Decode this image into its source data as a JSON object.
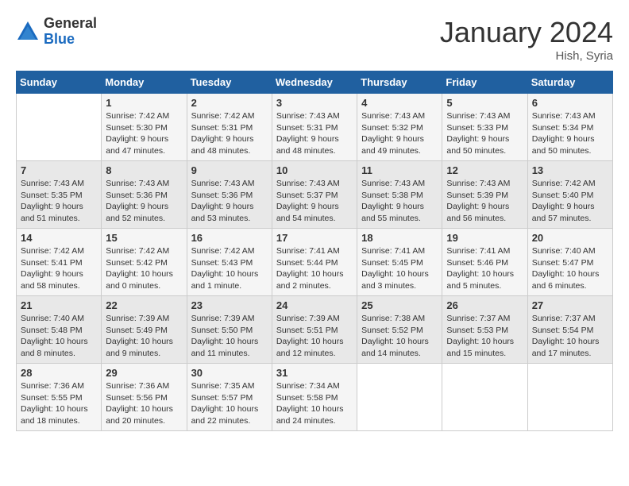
{
  "logo": {
    "general": "General",
    "blue": "Blue"
  },
  "title": "January 2024",
  "location": "Hish, Syria",
  "days_header": [
    "Sunday",
    "Monday",
    "Tuesday",
    "Wednesday",
    "Thursday",
    "Friday",
    "Saturday"
  ],
  "weeks": [
    [
      {
        "day": "",
        "info": ""
      },
      {
        "day": "1",
        "info": "Sunrise: 7:42 AM\nSunset: 5:30 PM\nDaylight: 9 hours and 47 minutes."
      },
      {
        "day": "2",
        "info": "Sunrise: 7:42 AM\nSunset: 5:31 PM\nDaylight: 9 hours and 48 minutes."
      },
      {
        "day": "3",
        "info": "Sunrise: 7:43 AM\nSunset: 5:31 PM\nDaylight: 9 hours and 48 minutes."
      },
      {
        "day": "4",
        "info": "Sunrise: 7:43 AM\nSunset: 5:32 PM\nDaylight: 9 hours and 49 minutes."
      },
      {
        "day": "5",
        "info": "Sunrise: 7:43 AM\nSunset: 5:33 PM\nDaylight: 9 hours and 50 minutes."
      },
      {
        "day": "6",
        "info": "Sunrise: 7:43 AM\nSunset: 5:34 PM\nDaylight: 9 hours and 50 minutes."
      }
    ],
    [
      {
        "day": "7",
        "info": "Sunrise: 7:43 AM\nSunset: 5:35 PM\nDaylight: 9 hours and 51 minutes."
      },
      {
        "day": "8",
        "info": "Sunrise: 7:43 AM\nSunset: 5:36 PM\nDaylight: 9 hours and 52 minutes."
      },
      {
        "day": "9",
        "info": "Sunrise: 7:43 AM\nSunset: 5:36 PM\nDaylight: 9 hours and 53 minutes."
      },
      {
        "day": "10",
        "info": "Sunrise: 7:43 AM\nSunset: 5:37 PM\nDaylight: 9 hours and 54 minutes."
      },
      {
        "day": "11",
        "info": "Sunrise: 7:43 AM\nSunset: 5:38 PM\nDaylight: 9 hours and 55 minutes."
      },
      {
        "day": "12",
        "info": "Sunrise: 7:43 AM\nSunset: 5:39 PM\nDaylight: 9 hours and 56 minutes."
      },
      {
        "day": "13",
        "info": "Sunrise: 7:42 AM\nSunset: 5:40 PM\nDaylight: 9 hours and 57 minutes."
      }
    ],
    [
      {
        "day": "14",
        "info": "Sunrise: 7:42 AM\nSunset: 5:41 PM\nDaylight: 9 hours and 58 minutes."
      },
      {
        "day": "15",
        "info": "Sunrise: 7:42 AM\nSunset: 5:42 PM\nDaylight: 10 hours and 0 minutes."
      },
      {
        "day": "16",
        "info": "Sunrise: 7:42 AM\nSunset: 5:43 PM\nDaylight: 10 hours and 1 minute."
      },
      {
        "day": "17",
        "info": "Sunrise: 7:41 AM\nSunset: 5:44 PM\nDaylight: 10 hours and 2 minutes."
      },
      {
        "day": "18",
        "info": "Sunrise: 7:41 AM\nSunset: 5:45 PM\nDaylight: 10 hours and 3 minutes."
      },
      {
        "day": "19",
        "info": "Sunrise: 7:41 AM\nSunset: 5:46 PM\nDaylight: 10 hours and 5 minutes."
      },
      {
        "day": "20",
        "info": "Sunrise: 7:40 AM\nSunset: 5:47 PM\nDaylight: 10 hours and 6 minutes."
      }
    ],
    [
      {
        "day": "21",
        "info": "Sunrise: 7:40 AM\nSunset: 5:48 PM\nDaylight: 10 hours and 8 minutes."
      },
      {
        "day": "22",
        "info": "Sunrise: 7:39 AM\nSunset: 5:49 PM\nDaylight: 10 hours and 9 minutes."
      },
      {
        "day": "23",
        "info": "Sunrise: 7:39 AM\nSunset: 5:50 PM\nDaylight: 10 hours and 11 minutes."
      },
      {
        "day": "24",
        "info": "Sunrise: 7:39 AM\nSunset: 5:51 PM\nDaylight: 10 hours and 12 minutes."
      },
      {
        "day": "25",
        "info": "Sunrise: 7:38 AM\nSunset: 5:52 PM\nDaylight: 10 hours and 14 minutes."
      },
      {
        "day": "26",
        "info": "Sunrise: 7:37 AM\nSunset: 5:53 PM\nDaylight: 10 hours and 15 minutes."
      },
      {
        "day": "27",
        "info": "Sunrise: 7:37 AM\nSunset: 5:54 PM\nDaylight: 10 hours and 17 minutes."
      }
    ],
    [
      {
        "day": "28",
        "info": "Sunrise: 7:36 AM\nSunset: 5:55 PM\nDaylight: 10 hours and 18 minutes."
      },
      {
        "day": "29",
        "info": "Sunrise: 7:36 AM\nSunset: 5:56 PM\nDaylight: 10 hours and 20 minutes."
      },
      {
        "day": "30",
        "info": "Sunrise: 7:35 AM\nSunset: 5:57 PM\nDaylight: 10 hours and 22 minutes."
      },
      {
        "day": "31",
        "info": "Sunrise: 7:34 AM\nSunset: 5:58 PM\nDaylight: 10 hours and 24 minutes."
      },
      {
        "day": "",
        "info": ""
      },
      {
        "day": "",
        "info": ""
      },
      {
        "day": "",
        "info": ""
      }
    ]
  ]
}
